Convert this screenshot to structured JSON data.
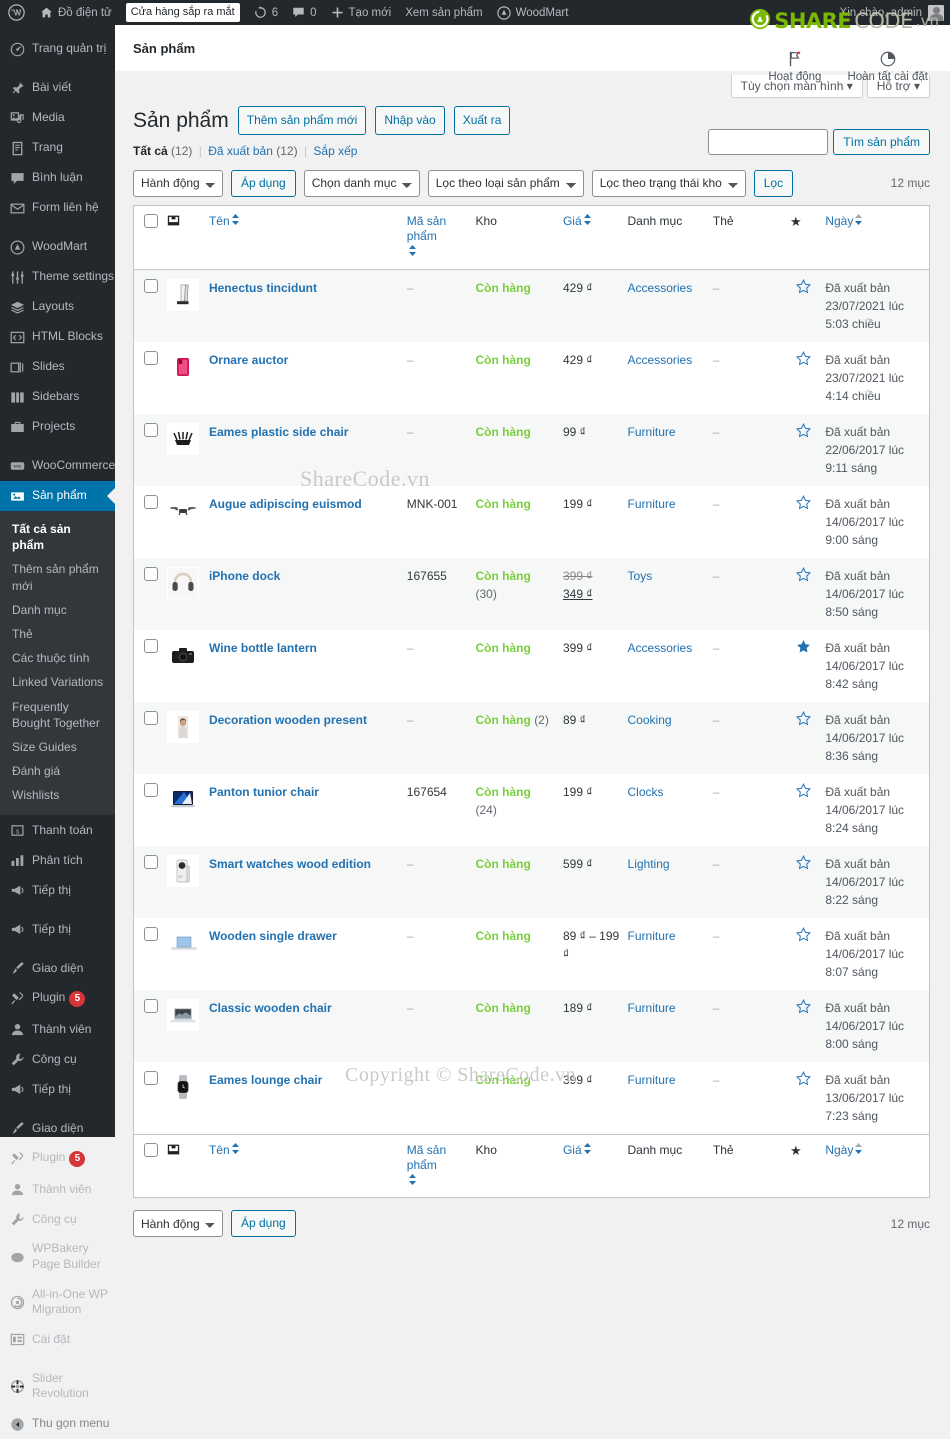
{
  "adminbar": {
    "site_name": "Đồ điện tử",
    "pill": "Cửa hàng sắp ra mắt",
    "updates_count": "6",
    "comments_count": "0",
    "new": "Tạo mới",
    "view_products": "Xem sản phẩm",
    "woodmart": "WoodMart",
    "greeting": "Xin chào, admin"
  },
  "sidebar": {
    "items": [
      {
        "label": "Trang quản trị",
        "icon": "dashboard-icon"
      },
      {
        "label": "Bài viết",
        "icon": "pin-icon"
      },
      {
        "label": "Media",
        "icon": "media-icon"
      },
      {
        "label": "Trang",
        "icon": "page-icon"
      },
      {
        "label": "Bình luận",
        "icon": "comment-icon"
      },
      {
        "label": "Form liên hệ",
        "icon": "envelope-icon"
      },
      {
        "label": "WoodMart",
        "icon": "woodmart-icon"
      },
      {
        "label": "Theme settings",
        "icon": "sliders-icon"
      },
      {
        "label": "Layouts",
        "icon": "layers-icon"
      },
      {
        "label": "HTML Blocks",
        "icon": "code-icon"
      },
      {
        "label": "Slides",
        "icon": "slides-icon"
      },
      {
        "label": "Sidebars",
        "icon": "sidebar-icon"
      },
      {
        "label": "Projects",
        "icon": "portfolio-icon"
      },
      {
        "label": "WooCommerce",
        "icon": "woo-icon"
      },
      {
        "label": "Sản phẩm",
        "icon": "products-icon",
        "current": true
      },
      {
        "label": "Thanh toán",
        "icon": "money-icon"
      },
      {
        "label": "Phân tích",
        "icon": "chart-icon"
      },
      {
        "label": "Tiếp thị",
        "icon": "megaphone-icon"
      },
      {
        "label": "Tiếp thị",
        "icon": "megaphone-icon"
      },
      {
        "label": "Giao diện",
        "icon": "brush-icon"
      },
      {
        "label": "Plugin",
        "icon": "plug-icon",
        "badge": "5"
      },
      {
        "label": "Thành viên",
        "icon": "user-icon"
      },
      {
        "label": "Công cụ",
        "icon": "wrench-icon"
      },
      {
        "label": "Tiếp thị",
        "icon": "megaphone-icon"
      },
      {
        "label": "Giao diện",
        "icon": "brush-icon"
      },
      {
        "label": "Plugin",
        "icon": "plug-icon",
        "badge": "5"
      },
      {
        "label": "Thành viên",
        "icon": "user-icon"
      },
      {
        "label": "Công cụ",
        "icon": "wrench-icon"
      },
      {
        "label": "WPBakery Page Builder",
        "icon": "wpbakery-icon"
      },
      {
        "label": "All-in-One WP Migration",
        "icon": "migration-icon"
      },
      {
        "label": "Cài đặt",
        "icon": "settings-icon"
      },
      {
        "label": "Slider Revolution",
        "icon": "slider-revolution-icon"
      },
      {
        "label": "Thu gọn menu",
        "icon": "collapse-icon"
      }
    ],
    "submenu": [
      {
        "label": "Tất cả sản phẩm",
        "current": true
      },
      {
        "label": "Thêm sản phẩm mới"
      },
      {
        "label": "Danh mục"
      },
      {
        "label": "Thẻ"
      },
      {
        "label": "Các thuộc tính"
      },
      {
        "label": "Linked Variations"
      },
      {
        "label": "Frequently Bought Together"
      },
      {
        "label": "Size Guides"
      },
      {
        "label": "Đánh giá"
      },
      {
        "label": "Wishlists"
      }
    ]
  },
  "topbar": {
    "title": "Sản phẩm"
  },
  "screen_meta": {
    "options": "Tùy chọn màn hình",
    "help": "Hỗ trợ"
  },
  "header_actions": {
    "activity": "Hoạt động",
    "finish_setup": "Hoàn tất cài đặt"
  },
  "page": {
    "title": "Sản phẩm",
    "add_new": "Thêm sản phẩm mới",
    "import": "Nhập vào",
    "export": "Xuất ra"
  },
  "views": {
    "all_label": "Tất cả",
    "all_count": "(12)",
    "published_label": "Đã xuất bản",
    "published_count": "(12)",
    "sort_label": "Sắp xếp"
  },
  "search": {
    "value": "",
    "placeholder": "",
    "button": "Tìm sản phẩm"
  },
  "tablenav": {
    "bulk_action": "Hành động",
    "apply": "Áp dụng",
    "category": "Chọn danh mục",
    "product_type": "Lọc theo loại sản phẩm",
    "stock_status": "Lọc theo trạng thái kho",
    "filter": "Lọc",
    "count": "12 mục"
  },
  "table": {
    "columns": {
      "thumb": "",
      "name": "Tên",
      "sku": "Mã sản phẩm",
      "stock": "Kho",
      "price": "Giá",
      "category": "Danh mục",
      "tag": "Thẻ",
      "featured": "★",
      "date": "Ngày"
    },
    "rows": [
      {
        "thumb": "ps5-console-thumb",
        "name": "Henectus tincidunt",
        "sku": "–",
        "stock": "Còn hàng",
        "stock_qty": "",
        "price": "429 ₫",
        "price_sale": "",
        "category": "Accessories",
        "tag": "–",
        "featured": false,
        "status": "Đã xuất bản",
        "date": "23/07/2021 lúc 5:03 chiều"
      },
      {
        "thumb": "red-phone-thumb",
        "name": "Ornare auctor",
        "sku": "–",
        "stock": "Còn hàng",
        "stock_qty": "",
        "price": "429 ₫",
        "price_sale": "",
        "category": "Accessories",
        "tag": "–",
        "featured": false,
        "status": "Đã xuất bản",
        "date": "23/07/2021 lúc 4:14 chiều"
      },
      {
        "thumb": "router-thumb",
        "name": "Eames plastic side chair",
        "sku": "–",
        "stock": "Còn hàng",
        "stock_qty": "",
        "price": "99 ₫",
        "price_sale": "",
        "category": "Furniture",
        "tag": "–",
        "featured": false,
        "status": "Đã xuất bản",
        "date": "22/06/2017 lúc 9:11 sáng"
      },
      {
        "thumb": "drone-thumb",
        "name": "Augue adipiscing euismod",
        "sku": "MNK-001",
        "stock": "Còn hàng",
        "stock_qty": "",
        "price": "199 ₫",
        "price_sale": "",
        "category": "Furniture",
        "tag": "–",
        "featured": false,
        "status": "Đã xuất bản",
        "date": "14/06/2017 lúc 9:00 sáng"
      },
      {
        "thumb": "headphones-thumb",
        "name": "iPhone dock",
        "sku": "167655",
        "stock": "Còn hàng",
        "stock_qty": "(30)",
        "price": "399 ₫",
        "price_sale": "349 ₫",
        "category": "Toys",
        "tag": "–",
        "featured": false,
        "status": "Đã xuất bản",
        "date": "14/06/2017 lúc 8:50 sáng"
      },
      {
        "thumb": "camera-thumb",
        "name": "Wine bottle lantern",
        "sku": "–",
        "stock": "Còn hàng",
        "stock_qty": "",
        "price": "399 ₫",
        "price_sale": "",
        "category": "Accessories",
        "tag": "–",
        "featured": true,
        "status": "Đã xuất bản",
        "date": "14/06/2017 lúc 8:42 sáng"
      },
      {
        "thumb": "portrait-thumb",
        "name": "Decoration wooden present",
        "sku": "–",
        "stock": "Còn hàng",
        "stock_qty": "(2)",
        "price": "89 ₫",
        "price_sale": "",
        "category": "Cooking",
        "tag": "–",
        "featured": false,
        "status": "Đã xuất bản",
        "date": "14/06/2017 lúc 8:36 sáng"
      },
      {
        "thumb": "laptop-blue-thumb",
        "name": "Panton tunior chair",
        "sku": "167654",
        "stock": "Còn hàng",
        "stock_qty": "(24)",
        "price": "199 ₫",
        "price_sale": "",
        "category": "Clocks",
        "tag": "–",
        "featured": false,
        "status": "Đã xuất bản",
        "date": "14/06/2017 lúc 8:24 sáng"
      },
      {
        "thumb": "xbox-thumb",
        "name": "Smart watches wood edition",
        "sku": "–",
        "stock": "Còn hàng",
        "stock_qty": "",
        "price": "599 ₫",
        "price_sale": "",
        "category": "Lighting",
        "tag": "–",
        "featured": false,
        "status": "Đã xuất bản",
        "date": "14/06/2017 lúc 8:22 sáng"
      },
      {
        "thumb": "surface-thumb",
        "name": "Wooden single drawer",
        "sku": "–",
        "stock": "Còn hàng",
        "stock_qty": "",
        "price": "89 ₫ – 199 ₫",
        "price_sale": "",
        "category": "Furniture",
        "tag": "–",
        "featured": false,
        "status": "Đã xuất bản",
        "date": "14/06/2017 lúc 8:07 sáng"
      },
      {
        "thumb": "macbook-thumb",
        "name": "Classic wooden chair",
        "sku": "–",
        "stock": "Còn hàng",
        "stock_qty": "",
        "price": "189 ₫",
        "price_sale": "",
        "category": "Furniture",
        "tag": "–",
        "featured": false,
        "status": "Đã xuất bản",
        "date": "14/06/2017 lúc 8:00 sáng"
      },
      {
        "thumb": "watch-thumb",
        "name": "Eames lounge chair",
        "sku": "–",
        "stock": "Còn hàng",
        "stock_qty": "",
        "price": "399 ₫",
        "price_sale": "",
        "category": "Furniture",
        "tag": "–",
        "featured": false,
        "status": "Đã xuất bản",
        "date": "13/06/2017 lúc 7:23 sáng"
      }
    ]
  },
  "watermark": {
    "center": "ShareCode.vn",
    "footer": "Copyright © ShareCode.vn",
    "brand_share": "SHARE",
    "brand_code": "CODE",
    "brand_tld": ".vn"
  },
  "colors": {
    "sidebar_bg": "#23282d",
    "submenu_bg": "#32373c",
    "accent": "#0073aa",
    "link": "#2271b1",
    "instock": "#7ad03a",
    "badge": "#d63638",
    "brand_green": "#7ab800"
  }
}
